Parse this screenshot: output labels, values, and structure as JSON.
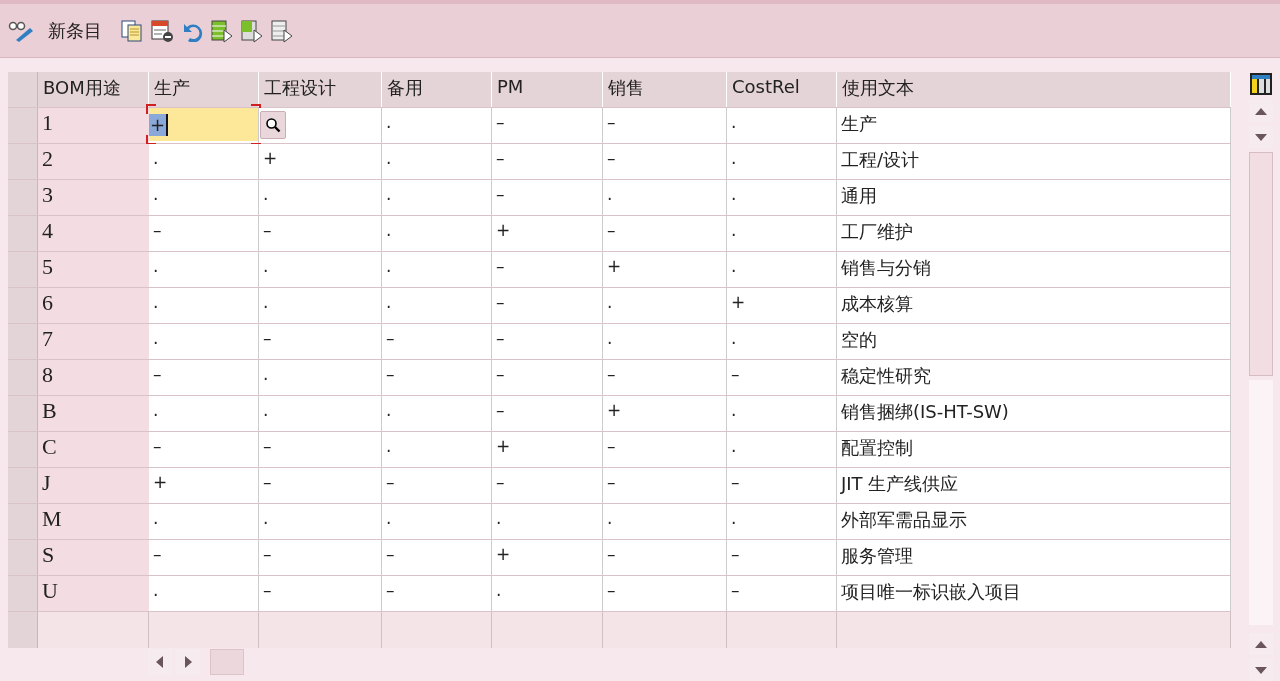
{
  "toolbar": {
    "new_entry": "新条目"
  },
  "table": {
    "columns": [
      "BOM用途",
      "生产",
      "工程设计",
      "备用",
      "PM",
      "销售",
      "CostRel",
      "使用文本"
    ],
    "rows": [
      {
        "cells": [
          "1",
          "+",
          "",
          ".",
          "–",
          "–",
          ".",
          "生产"
        ],
        "editing": true
      },
      {
        "cells": [
          "2",
          ".",
          "+",
          ".",
          "–",
          "–",
          ".",
          "工程/设计"
        ],
        "editing": false
      },
      {
        "cells": [
          "3",
          ".",
          ".",
          ".",
          "–",
          ".",
          ".",
          "通用"
        ],
        "editing": false
      },
      {
        "cells": [
          "4",
          "–",
          "–",
          ".",
          "+",
          "–",
          ".",
          "工厂维护"
        ],
        "editing": false
      },
      {
        "cells": [
          "5",
          ".",
          ".",
          ".",
          "–",
          "+",
          ".",
          "销售与分销"
        ],
        "editing": false
      },
      {
        "cells": [
          "6",
          ".",
          ".",
          ".",
          "–",
          ".",
          "+",
          "成本核算"
        ],
        "editing": false
      },
      {
        "cells": [
          "7",
          ".",
          "–",
          "–",
          "–",
          ".",
          ".",
          "空的"
        ],
        "editing": false
      },
      {
        "cells": [
          "8",
          "–",
          ".",
          "–",
          "–",
          "–",
          "–",
          "稳定性研究"
        ],
        "editing": false
      },
      {
        "cells": [
          "B",
          ".",
          ".",
          ".",
          "–",
          "+",
          ".",
          "销售捆绑(IS-HT-SW)"
        ],
        "editing": false
      },
      {
        "cells": [
          "C",
          "–",
          "–",
          ".",
          "+",
          "–",
          ".",
          "配置控制"
        ],
        "editing": false
      },
      {
        "cells": [
          "J",
          "+",
          "–",
          "–",
          "–",
          "–",
          "–",
          "JIT 生产线供应"
        ],
        "editing": false
      },
      {
        "cells": [
          "M",
          ".",
          ".",
          ".",
          ".",
          ".",
          ".",
          "外部军需品显示"
        ],
        "editing": false
      },
      {
        "cells": [
          "S",
          "–",
          "–",
          "–",
          "+",
          "–",
          "–",
          "服务管理"
        ],
        "editing": false
      },
      {
        "cells": [
          "U",
          ".",
          "–",
          "–",
          ".",
          "–",
          "–",
          "项目唯一标识嵌入项目"
        ],
        "editing": false
      }
    ]
  }
}
